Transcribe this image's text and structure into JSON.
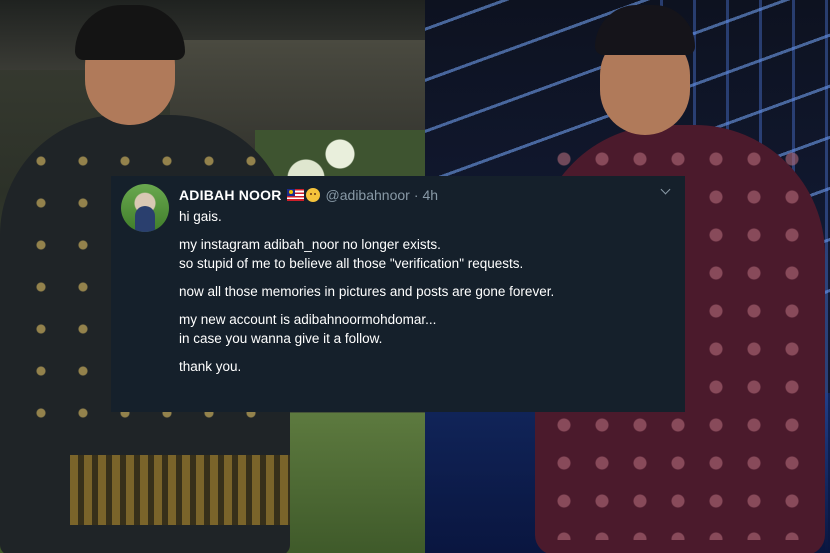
{
  "tweet": {
    "display_name": "ADIBAH NOOR",
    "handle": "@adibahnoor",
    "separator": "·",
    "time": "4h",
    "flag_icon": "malaysia-flag-icon",
    "emoji_icon": "face-emoji-icon",
    "lines": [
      "hi gais.",
      "my instagram adibah_noor no longer exists.",
      "so stupid of me to believe all those \"verification\" requests.",
      "now all those memories in pictures and posts are gone forever.",
      "my new account is adibahnoormohdomar...",
      "in case you wanna give it a follow.",
      "thank you."
    ]
  },
  "colors": {
    "card_background": "#15202b",
    "primary_text": "#ffffff",
    "secondary_text": "#8899a6"
  }
}
